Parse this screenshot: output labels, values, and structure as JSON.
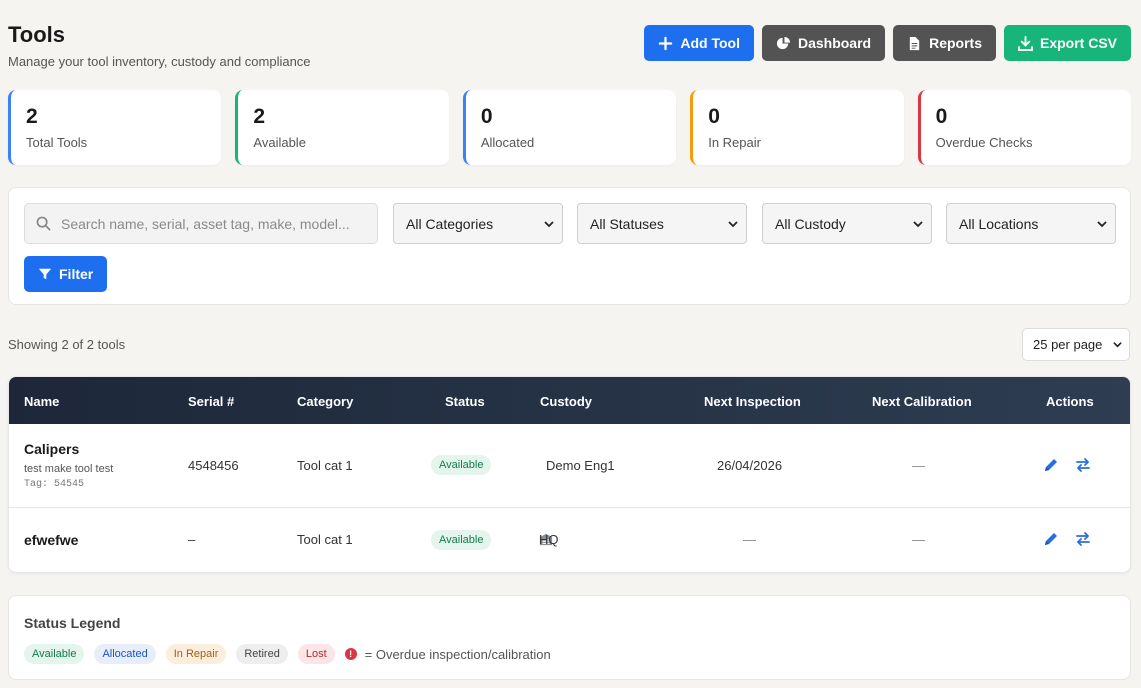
{
  "header": {
    "title": "Tools",
    "subtitle": "Manage your tool inventory, custody and compliance"
  },
  "actions": {
    "add_tool": "Add Tool",
    "dashboard": "Dashboard",
    "reports": "Reports",
    "export_csv": "Export CSV"
  },
  "stats": [
    {
      "value": "2",
      "label": "Total Tools",
      "color": "#3b82f6"
    },
    {
      "value": "2",
      "label": "Available",
      "color": "#17b57a"
    },
    {
      "value": "0",
      "label": "Allocated",
      "color": "#3b82f6"
    },
    {
      "value": "0",
      "label": "In Repair",
      "color": "#f59e0b"
    },
    {
      "value": "0",
      "label": "Overdue Checks",
      "color": "#dc3545"
    }
  ],
  "filters": {
    "search_placeholder": "Search name, serial, asset tag, make, model...",
    "category": "All Categories",
    "status": "All Statuses",
    "custody": "All Custody",
    "location": "All Locations",
    "filter_button": "Filter"
  },
  "listing": {
    "showing": "Showing 2 of 2 tools",
    "per_page": "25 per page"
  },
  "table": {
    "columns": [
      "Name",
      "Serial #",
      "Category",
      "Status",
      "Custody",
      "Next Inspection",
      "Next Calibration",
      "Actions"
    ],
    "rows": [
      {
        "name": "Calipers",
        "make": "test make tool test",
        "tag": "Tag: 54545",
        "serial": "4548456",
        "category": "Tool cat 1",
        "status": "Available",
        "custody": "Demo Eng1",
        "next_inspection": "26/04/2026",
        "next_calibration": "—"
      },
      {
        "name": "efwefwe",
        "serial": "–",
        "category": "Tool cat 1",
        "status": "Available",
        "custody": "HQ",
        "next_inspection": "—",
        "next_calibration": "—"
      }
    ]
  },
  "legend": {
    "title": "Status Legend",
    "items": [
      "Available",
      "Allocated",
      "In Repair",
      "Retired",
      "Lost"
    ],
    "overdue_marker": "!",
    "overdue_text": "= Overdue inspection/calibration"
  }
}
